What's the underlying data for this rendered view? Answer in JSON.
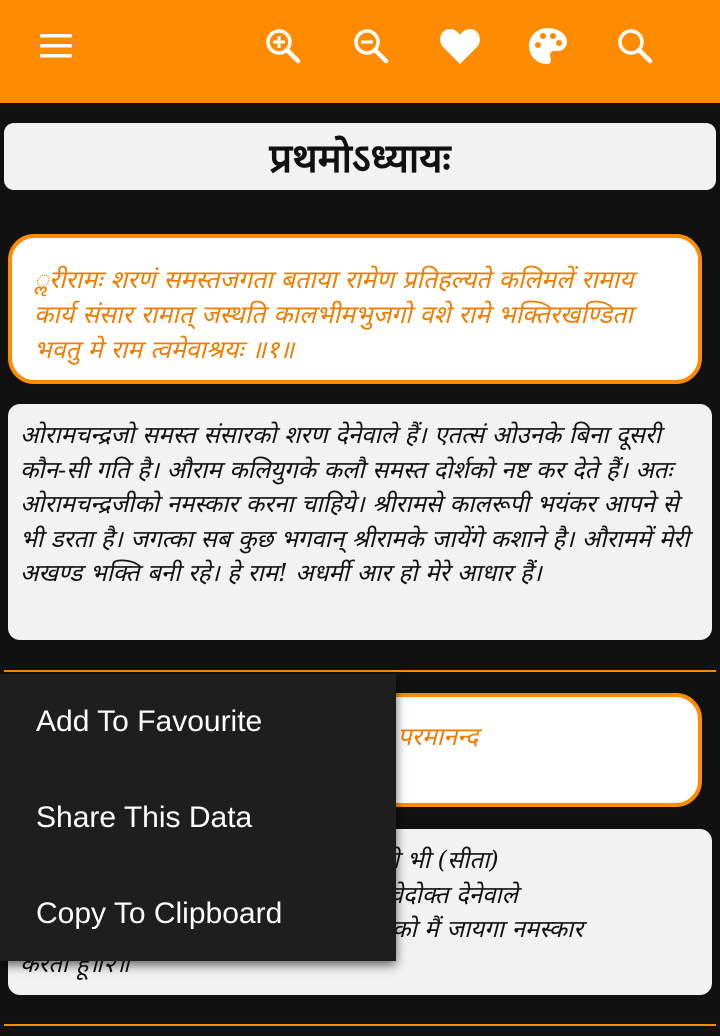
{
  "toolbar": {
    "icons": [
      "menu-icon",
      "zoom-in-icon",
      "zoom-out-icon",
      "heart-icon",
      "palette-icon",
      "search-icon"
    ],
    "accent_color": "#FF8C00"
  },
  "chapter": {
    "title": "प्रथमोऽध्यायः"
  },
  "verse1": {
    "text": "ॢरीरामः शरणं समस्तजगता बताया रामेण प्रतिहल्यते कलिमलें रामाय कार्य  संसार  रामात् जस्थति कालभीमभुजगो वशे  रामे भक्तिरखण्डिता भवतु मे राम त्वमेवाश्रयः ॥१॥"
  },
  "meaning1": {
    "text": "ओरामचन्द्रजो समस्त संसारको शरण देनेवाले हैं। एतत्सं ओउनके बिना दूसरी कौन-सी गति है। औराम कलियुगके कलौ समस्त दोर्शको नष्ट कर देते हैं। अतः ओरामचन्द्रजीको नमस्कार करना चाहिये। श्रीरामसे कालरूपी भयंकर आपने से भी डरता है। जगत्का सब कुछ भगवान् श्रीरामके जायेंगे कशाने है। औराममें मेरी अखण्ड भक्ति बनी रहे। हे राम! अधर्मी आर हो मेरे आधार हैं।"
  },
  "verse2": {
    "text_visible": "। परमानन्द"
  },
  "meaning2": {
    "line1": "क्ष्मी भी (सीता)",
    "line2": "य वेदोक्त देनेवाले",
    "line3": "जीको मैं जायगा नमस्कार",
    "line4": "करता हूँ॥२॥"
  },
  "context_menu": {
    "items": [
      "Add To Favourite",
      "Share This Data",
      "Copy To Clipboard"
    ]
  }
}
